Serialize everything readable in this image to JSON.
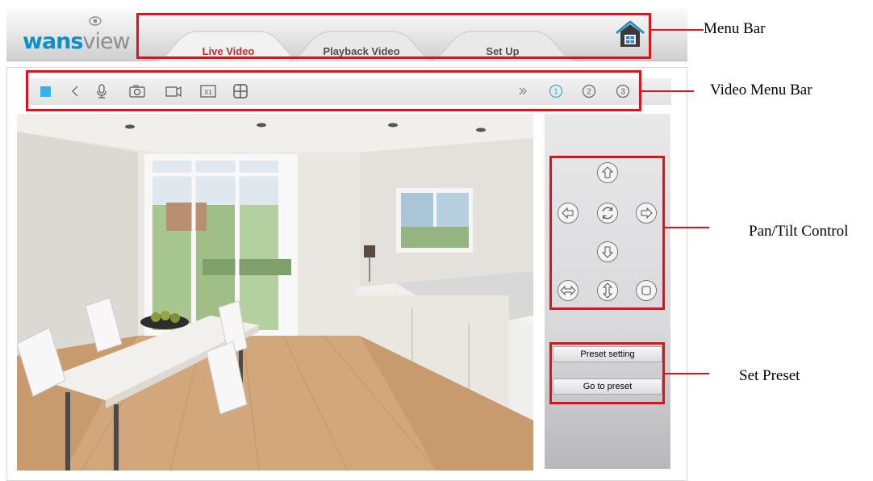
{
  "brand": {
    "logo_text_a": "wans",
    "logo_text_b": "view"
  },
  "menu": {
    "tabs": [
      {
        "label": "Live Video",
        "active": true
      },
      {
        "label": "Playback Video",
        "active": false
      },
      {
        "label": "Set Up",
        "active": false
      }
    ],
    "home_icon": "home-icon"
  },
  "video_toolbar": {
    "buttons": [
      {
        "icon": "stop-icon"
      },
      {
        "icon": "speaker-icon"
      },
      {
        "icon": "microphone-icon"
      },
      {
        "icon": "camera-snapshot-icon"
      },
      {
        "icon": "video-record-icon"
      },
      {
        "icon": "zoom-x1-icon",
        "text": "X1"
      },
      {
        "icon": "multi-view-grid-icon"
      }
    ],
    "stream_buttons": [
      {
        "icon": "fast-forward-icon"
      },
      {
        "icon": "stream-1-icon",
        "text": "1"
      },
      {
        "icon": "stream-2-icon",
        "text": "2"
      },
      {
        "icon": "stream-3-icon",
        "text": "3"
      }
    ]
  },
  "ptz": {
    "buttons": [
      "arrow-up-icon",
      "arrow-left-icon",
      "rotate-icon",
      "arrow-right-icon",
      "arrow-down-icon",
      "horizontal-cruise-icon",
      "vertical-cruise-icon",
      "stop-cruise-icon"
    ]
  },
  "presets": {
    "setting_label": "Preset setting",
    "goto_label": "Go to preset"
  },
  "annotations": {
    "menu_bar": "Menu Bar",
    "video_menu_bar": "Video Menu Bar",
    "pan_tilt": "Pan/Tilt Control",
    "set_preset": "Set Preset"
  },
  "colors": {
    "brand_blue": "#0d8fc9",
    "active_tab_red": "#c8282c",
    "annotation_red": "#e0101c",
    "stream_active": "#33a8e0"
  }
}
